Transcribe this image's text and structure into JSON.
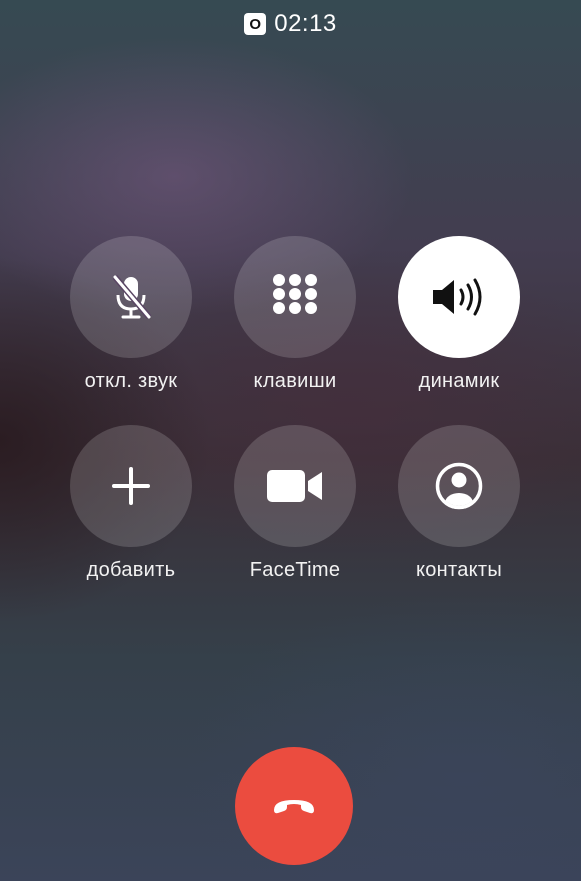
{
  "status": {
    "badge": "O",
    "time": "02:13"
  },
  "controls": {
    "mute": {
      "label": "откл. звук",
      "icon": "microphone-slash-icon"
    },
    "keypad": {
      "label": "клавиши",
      "icon": "keypad-icon"
    },
    "speaker": {
      "label": "динамик",
      "icon": "speaker-icon",
      "active": true
    },
    "add": {
      "label": "добавить",
      "icon": "plus-icon"
    },
    "facetime": {
      "label": "FaceTime",
      "icon": "video-camera-icon"
    },
    "contacts": {
      "label": "контакты",
      "icon": "person-circle-icon"
    }
  },
  "end_call": {
    "icon": "phone-hangup-icon",
    "color": "#eb4c3f"
  },
  "colors": {
    "button_bg": "rgba(255,255,255,0.16)",
    "active_button_bg": "#ffffff",
    "text": "#ffffff"
  }
}
